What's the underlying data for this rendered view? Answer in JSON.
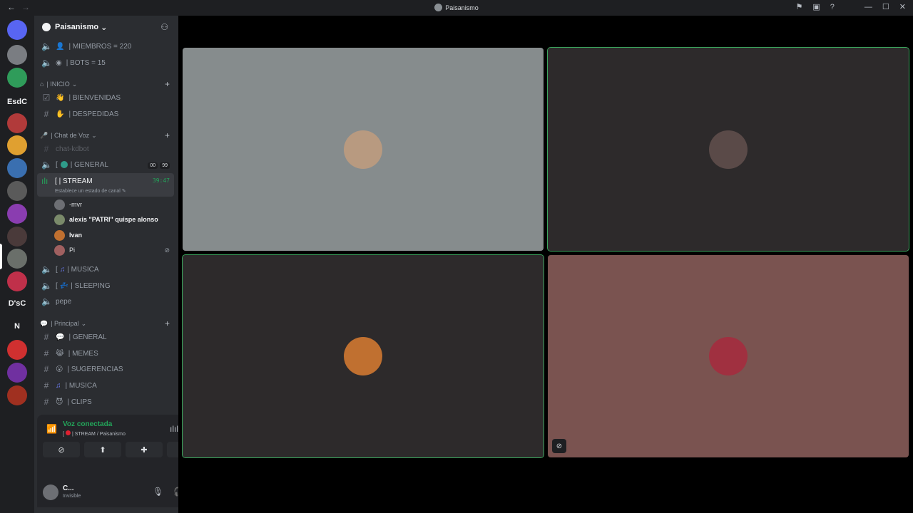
{
  "titlebar": {
    "title": "Paisanismo",
    "back": "←",
    "forward": "→"
  },
  "guild": {
    "name": "Paisanismo",
    "chevron": "⌄"
  },
  "servers": [
    {
      "label": "",
      "color": "#5865f2"
    },
    {
      "label": "",
      "color": "#7a7d82"
    },
    {
      "label": "",
      "color": "#2f9c5a"
    },
    {
      "label": "EsdC",
      "color": ""
    },
    {
      "label": "",
      "color": "#b13a3a"
    },
    {
      "label": "",
      "color": "#e0a030"
    },
    {
      "label": "",
      "color": "#3a6fb0"
    },
    {
      "label": "",
      "color": "#5a5a5a"
    },
    {
      "label": "",
      "color": "#8a3db0"
    },
    {
      "label": "",
      "color": "#4a3a3a"
    },
    {
      "label": "",
      "color": "#6a6f6a"
    },
    {
      "label": "",
      "color": "#c0304a"
    },
    {
      "label": "D'sC",
      "color": ""
    },
    {
      "label": "N",
      "color": ""
    },
    {
      "label": "",
      "color": "#d03030"
    },
    {
      "label": "",
      "color": "#7030a0"
    },
    {
      "label": "",
      "color": "#a03020"
    }
  ],
  "channels": {
    "stats": [
      "| MIEMBROS = 220",
      "| BOTS = 15"
    ],
    "cat_inicio": "| INICIO",
    "inicio": [
      "| BIENVENIDAS",
      "| DESPEDIDAS"
    ],
    "cat_voz": "| Chat de Voz",
    "voz_pre": [
      "chat-kdbot",
      "| GENERAL"
    ],
    "general_badges": [
      "00",
      "99"
    ],
    "stream": {
      "name": "| STREAM",
      "time": "39:47",
      "status": "Establece un estado de canal"
    },
    "members": [
      {
        "name": "-mvr",
        "bold": false,
        "color": "#6d6f74"
      },
      {
        "name": "alexis \"PATRI\" quispe alonso",
        "bold": true,
        "color": "#7a8a6a"
      },
      {
        "name": "Ivan",
        "bold": true,
        "color": "#c07030"
      },
      {
        "name": "Pi",
        "bold": false,
        "color": "#a06060"
      }
    ],
    "voz_post": [
      "| MUSICA",
      "| SLEEPING",
      "pepe"
    ],
    "cat_principal": "| Principal",
    "principal": [
      "| GENERAL",
      "| MEMES",
      "| SUGERENCIAS",
      "| MUSICA",
      "| CLIPS"
    ]
  },
  "voice": {
    "connected": "Voz conectada",
    "sub": "| STREAM / Paisanismo"
  },
  "user": {
    "name": "C...",
    "status": "Invisible"
  },
  "tiles": [
    {
      "bg": "#868c8d",
      "avatar": "#b89a80",
      "speaking": false
    },
    {
      "bg": "#2d2a2b",
      "avatar": "#5a4a48",
      "speaking": true
    },
    {
      "bg": "#2d2a2b",
      "avatar": "#c07030",
      "speaking": true
    },
    {
      "bg": "#7a5350",
      "avatar": "#a03040",
      "speaking": false
    }
  ],
  "colors": {
    "accent_green": "#23a55a",
    "bg_sidebar": "#2b2d31",
    "bg_rail": "#1e1f22"
  }
}
